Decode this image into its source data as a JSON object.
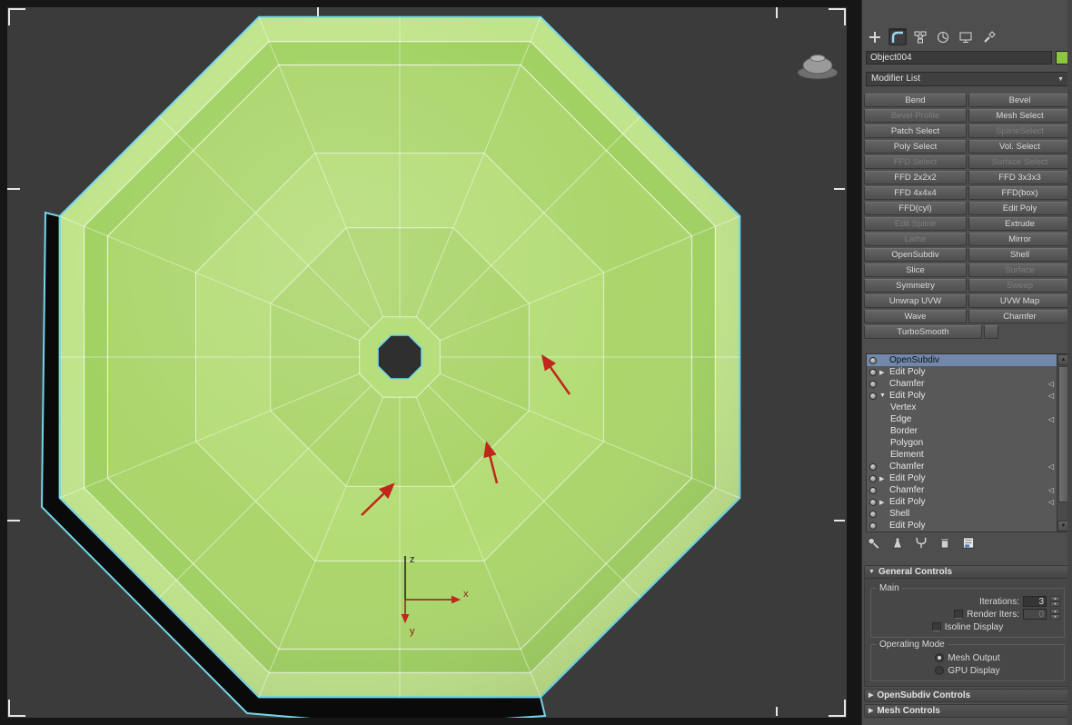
{
  "colors": {
    "object_swatch": "#8CC63E",
    "selection_outline": "#74D7EA",
    "annotation_arrow": "#C0261A",
    "object_fill": "#AAD66B",
    "stack_selected": "#7288AB"
  },
  "viewport": {
    "axis_labels": {
      "x": "x",
      "y": "y",
      "z": "z"
    }
  },
  "panel": {
    "tabs": [
      {
        "name": "Create"
      },
      {
        "name": "Modify"
      },
      {
        "name": "Hierarchy"
      },
      {
        "name": "Motion"
      },
      {
        "name": "Display"
      },
      {
        "name": "Utilities"
      }
    ],
    "object_name": "Object004",
    "modifier_list_label": "Modifier List",
    "modifier_buttons": [
      {
        "label": "Bend",
        "enabled": true
      },
      {
        "label": "Bevel",
        "enabled": true
      },
      {
        "label": "Bevel Profile",
        "enabled": false
      },
      {
        "label": "Mesh Select",
        "enabled": true
      },
      {
        "label": "Patch Select",
        "enabled": true
      },
      {
        "label": "SplineSelect",
        "enabled": false
      },
      {
        "label": "Poly Select",
        "enabled": true
      },
      {
        "label": "Vol. Select",
        "enabled": true
      },
      {
        "label": "FFD Select",
        "enabled": false
      },
      {
        "label": "Surface Select",
        "enabled": false
      },
      {
        "label": "FFD 2x2x2",
        "enabled": true
      },
      {
        "label": "FFD 3x3x3",
        "enabled": true
      },
      {
        "label": "FFD 4x4x4",
        "enabled": true
      },
      {
        "label": "FFD(box)",
        "enabled": true
      },
      {
        "label": "FFD(cyl)",
        "enabled": true
      },
      {
        "label": "Edit Poly",
        "enabled": true
      },
      {
        "label": "Edit Spline",
        "enabled": false
      },
      {
        "label": "Extrude",
        "enabled": true
      },
      {
        "label": "Lathe",
        "enabled": false
      },
      {
        "label": "Mirror",
        "enabled": true
      },
      {
        "label": "OpenSubdiv",
        "enabled": true
      },
      {
        "label": "Shell",
        "enabled": true
      },
      {
        "label": "Slice",
        "enabled": true
      },
      {
        "label": "Surface",
        "enabled": false
      },
      {
        "label": "Symmetry",
        "enabled": true
      },
      {
        "label": "Sweep",
        "enabled": false
      },
      {
        "label": "Unwrap UVW",
        "enabled": true
      },
      {
        "label": "UVW Map",
        "enabled": true
      },
      {
        "label": "Wave",
        "enabled": true
      },
      {
        "label": "Chamfer",
        "enabled": true
      },
      {
        "label": "TurboSmooth",
        "enabled": true
      }
    ],
    "stack": {
      "items": [
        {
          "label": "OpenSubdiv",
          "selected": true
        },
        {
          "label": "Edit Poly",
          "collapsed": true
        },
        {
          "label": "Chamfer",
          "flag": true
        },
        {
          "label": "Edit Poly",
          "expanded": true,
          "flag": true
        },
        {
          "label": "Vertex",
          "sub": true
        },
        {
          "label": "Edge",
          "sub": true,
          "flag": true
        },
        {
          "label": "Border",
          "sub": true
        },
        {
          "label": "Polygon",
          "sub": true
        },
        {
          "label": "Element",
          "sub": true
        },
        {
          "label": "Chamfer",
          "flag": true
        },
        {
          "label": "Edit Poly",
          "collapsed": true
        },
        {
          "label": "Chamfer",
          "flag": true
        },
        {
          "label": "Edit Poly",
          "collapsed": true,
          "flag": true
        },
        {
          "label": "Shell"
        },
        {
          "label": "Edit Poly"
        }
      ]
    },
    "stack_tools": [
      {
        "name": "Pin Stack"
      },
      {
        "name": "Show End Result"
      },
      {
        "name": "Make Unique"
      },
      {
        "name": "Remove Modifier"
      },
      {
        "name": "Configure Modifier Sets"
      }
    ],
    "rollouts": {
      "general_controls": {
        "title": "General Controls",
        "group_main": "Main",
        "iterations_label": "Iterations:",
        "iterations_value": "3",
        "render_iters_label": "Render Iters:",
        "render_iters_value": "0",
        "isoline_label": "Isoline Display",
        "group_mode": "Operating Mode",
        "mode_options": [
          "Mesh Output",
          "GPU Display"
        ],
        "mode_selected": "Mesh Output"
      },
      "opensubdiv_controls": {
        "title": "OpenSubdiv Controls"
      },
      "mesh_controls": {
        "title": "Mesh Controls"
      }
    }
  }
}
